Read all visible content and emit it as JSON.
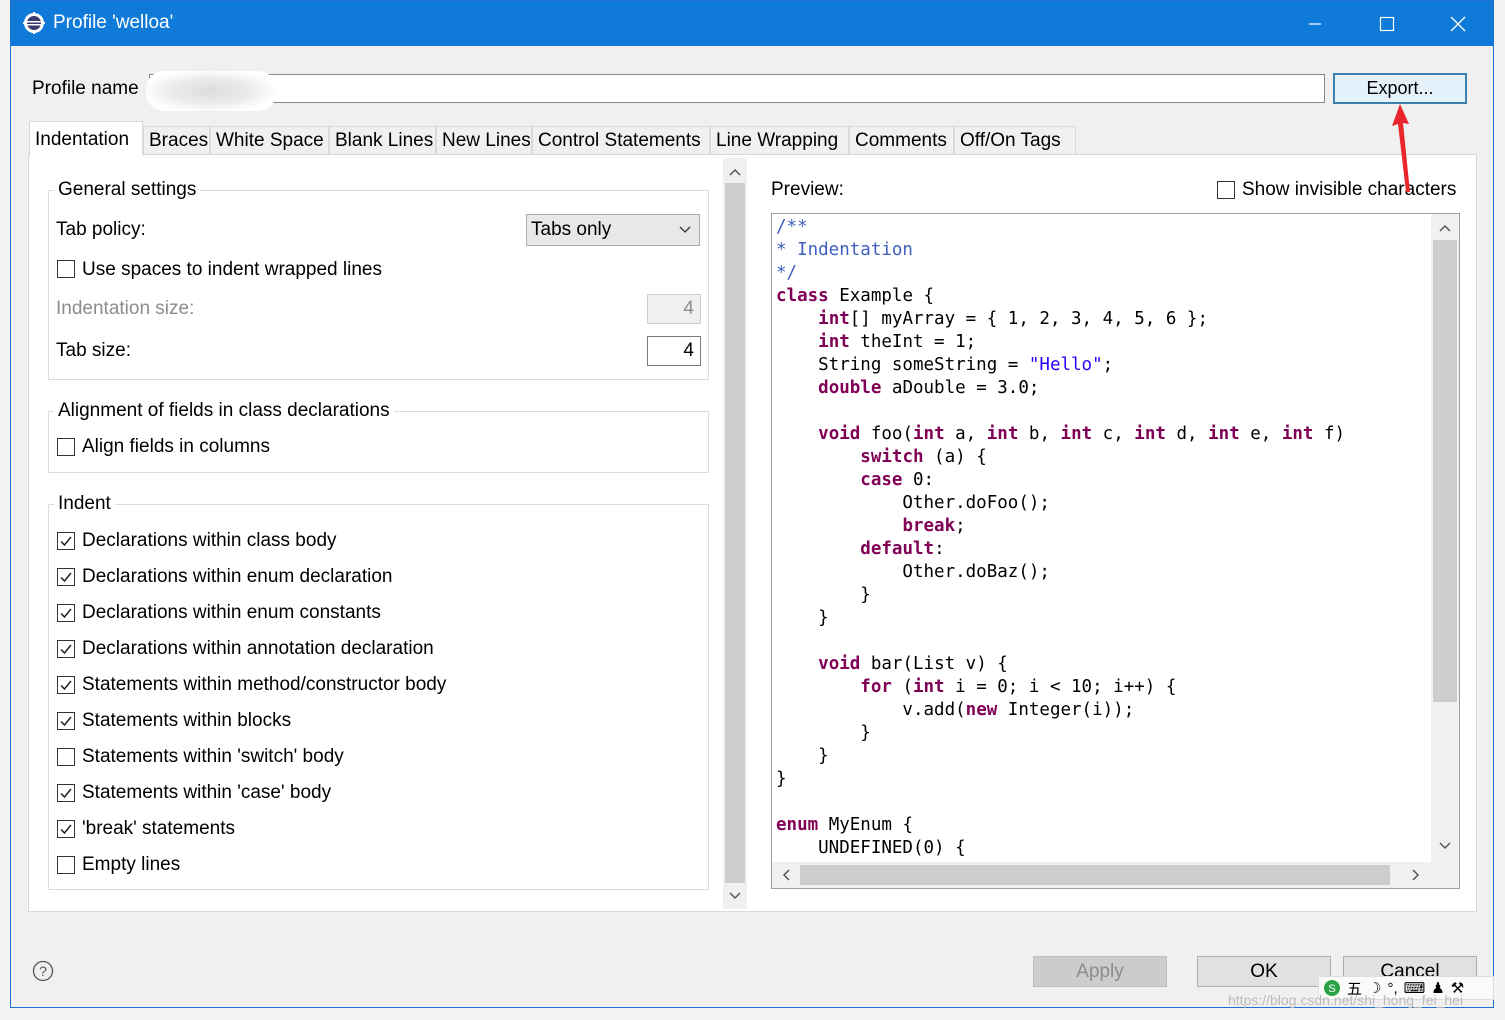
{
  "window": {
    "title": "Profile 'welloa'",
    "profile_name_label": "Profile name",
    "profile_name_value": "",
    "export_button": "Export..."
  },
  "tabs": [
    "Indentation",
    "Braces",
    "White Space",
    "Blank Lines",
    "New Lines",
    "Control Statements",
    "Line Wrapping",
    "Comments",
    "Off/On Tags"
  ],
  "active_tab": "Indentation",
  "general": {
    "title": "General settings",
    "tab_policy_label": "Tab policy:",
    "tab_policy_value": "Tabs only",
    "use_spaces_label": "Use spaces to indent wrapped lines",
    "use_spaces_checked": false,
    "indentation_size_label": "Indentation size:",
    "indentation_size_value": "4",
    "tab_size_label": "Tab size:",
    "tab_size_value": "4"
  },
  "alignment": {
    "title": "Alignment of fields in class declarations",
    "align_fields_label": "Align fields in columns",
    "align_fields_checked": false
  },
  "indent": {
    "title": "Indent",
    "items": [
      {
        "label": "Declarations within class body",
        "checked": true
      },
      {
        "label": "Declarations within enum declaration",
        "checked": true
      },
      {
        "label": "Declarations within enum constants",
        "checked": true
      },
      {
        "label": "Declarations within annotation declaration",
        "checked": true
      },
      {
        "label": "Statements within method/constructor body",
        "checked": true
      },
      {
        "label": "Statements within blocks",
        "checked": true
      },
      {
        "label": "Statements within 'switch' body",
        "checked": false
      },
      {
        "label": "Statements within 'case' body",
        "checked": true
      },
      {
        "label": "'break' statements",
        "checked": true
      },
      {
        "label": "Empty lines",
        "checked": false
      }
    ]
  },
  "preview": {
    "label": "Preview:",
    "show_invisible_label": "Show invisible characters",
    "show_invisible_checked": false
  },
  "buttons": {
    "apply": "Apply",
    "ok": "OK",
    "cancel": "Cancel"
  },
  "tray": {
    "ime_label": "五"
  },
  "watermark": "https://blog.csdn.net/shi_hong_fei_hei",
  "colors": {
    "titlebar": "#0f7ad8",
    "keyword": "#7f0055",
    "comment": "#3f5fbf",
    "string": "#2a00ff",
    "annotation_arrow": "#e8262b"
  }
}
